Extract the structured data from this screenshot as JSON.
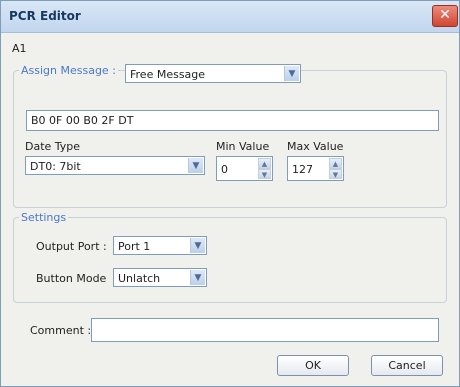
{
  "title": "PCR Editor",
  "close_icon": "close-icon",
  "accent_color": "#4b78c8",
  "header_text": "A1",
  "assign": {
    "label": "Assign Message :",
    "selected": "Free Message",
    "message_value": "B0 0F 00 B0 2F DT",
    "date_type_label": "Date Type",
    "date_type_value": "DT0: 7bit",
    "min_label": "Min Value",
    "min_value": "0",
    "max_label": "Max Value",
    "max_value": "127"
  },
  "settings": {
    "title": "Settings",
    "output_label": "Output Port :",
    "output_value": "Port 1",
    "button_mode_label": "Button Mode",
    "button_mode_value": "Unlatch"
  },
  "comment": {
    "label": "Comment :",
    "value": ""
  },
  "buttons": {
    "ok": "OK",
    "cancel": "Cancel"
  }
}
